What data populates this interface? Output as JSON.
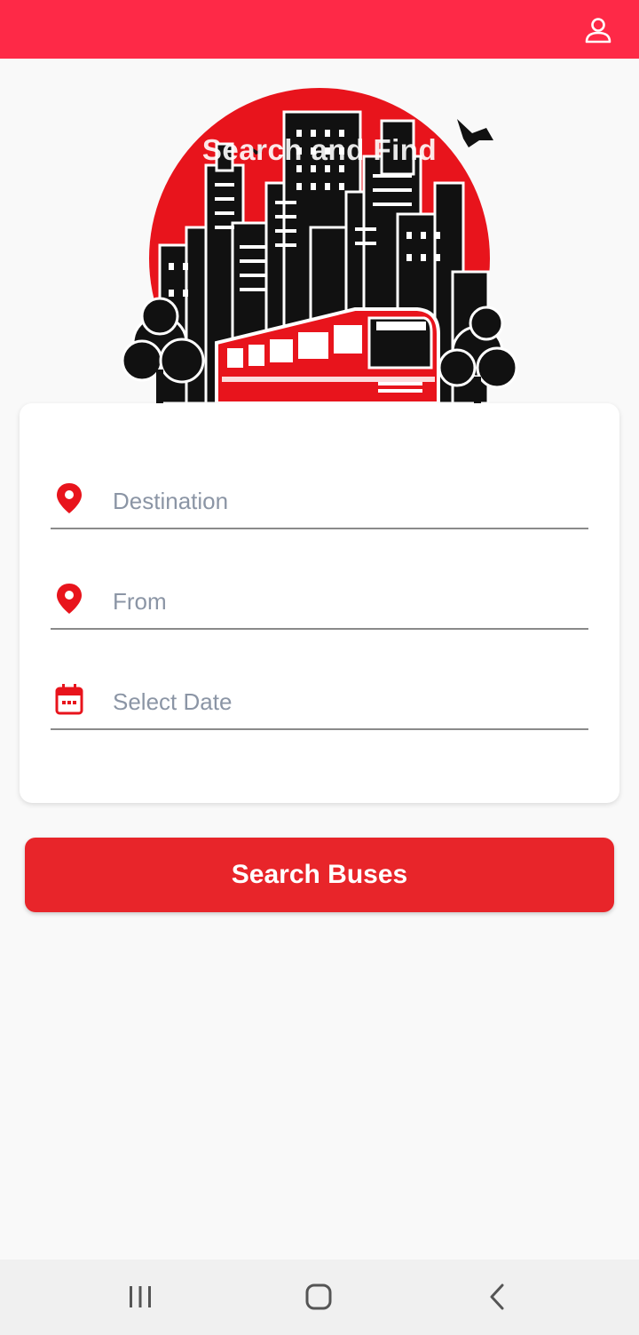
{
  "app": {
    "hero_title": "Search and Find",
    "colors": {
      "topbar": "#fe2947",
      "accent": "#e8252a",
      "icon_red": "#e8141c"
    }
  },
  "header": {
    "profile_icon": "person-icon"
  },
  "form": {
    "destination": {
      "placeholder": "Destination",
      "value": "",
      "icon": "location-pin-icon"
    },
    "from": {
      "placeholder": "From",
      "value": "",
      "icon": "location-pin-icon"
    },
    "date": {
      "placeholder": "Select Date",
      "value": "",
      "icon": "calendar-icon"
    }
  },
  "actions": {
    "search_label": "Search Buses"
  },
  "system_nav": {
    "recents_icon": "recent-apps-icon",
    "home_icon": "home-icon",
    "back_icon": "back-icon"
  }
}
